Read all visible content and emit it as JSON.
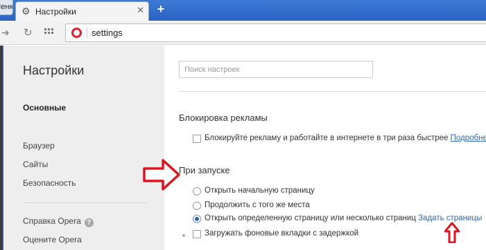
{
  "tabstrip": {
    "menu_stub": "Меню",
    "tab_title": "Настройки",
    "tab_icon": "gear-icon",
    "close_icon": "close-icon",
    "new_tab_label": "+"
  },
  "address_bar": {
    "url": "settings",
    "brand_icon": "opera-logo-icon",
    "brand_color": "#e0202a"
  },
  "sidebar": {
    "title": "Настройки",
    "active_item": "Основные",
    "items": [
      "Браузер",
      "Сайты",
      "Безопасность"
    ],
    "footer_items": [
      "Справка Opera",
      "Оцените Opera"
    ]
  },
  "main": {
    "search_placeholder": "Поиск настроек",
    "ad_block": {
      "title": "Блокировка рекламы",
      "checkbox_label": "Блокируйте рекламу и работайте в интернете в три раза быстрее",
      "more_link": "Подробнее…",
      "checked": false
    },
    "startup": {
      "title": "При запуске",
      "options": [
        {
          "label": "Открыть начальную страницу",
          "selected": false
        },
        {
          "label": "Продолжить с того же места",
          "selected": false
        },
        {
          "label": "Открыть определенную страницу или несколько страниц",
          "selected": true
        }
      ],
      "set_pages_link": "Задать страницы",
      "background_tabs_label": "Загружать фоновые вкладки с задержкой",
      "background_tabs_checked": false
    }
  },
  "annotations": {
    "color": "#e0141e"
  }
}
